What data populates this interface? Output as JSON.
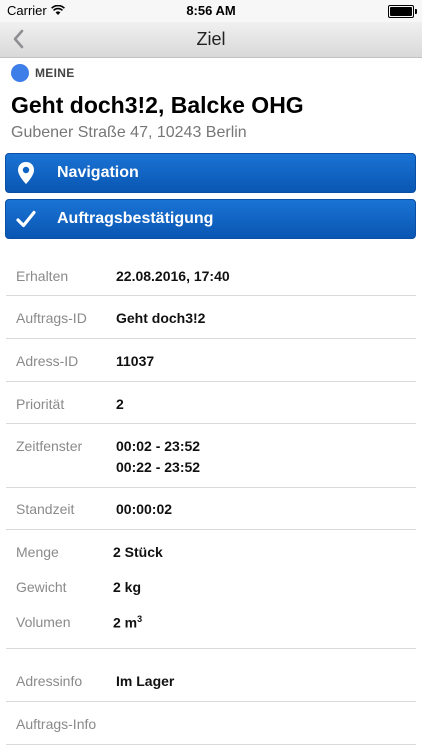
{
  "status_bar": {
    "carrier": "Carrier",
    "time": "8:56 AM",
    "battery_level": 1.0
  },
  "navbar": {
    "title": "Ziel"
  },
  "owner": {
    "label": "MEINE",
    "color": "#3d7ee8"
  },
  "destination": {
    "title": "Geht doch3!2, Balcke OHG",
    "address": "Gubener Straße 47, 10243 Berlin"
  },
  "actions": {
    "navigation_label": "Navigation",
    "confirm_label": "Auftragsbestätigung",
    "button_color": "#0f63c4"
  },
  "details": {
    "erhalten": {
      "label": "Erhalten",
      "value": "22.08.2016, 17:40"
    },
    "auftrags_id": {
      "label": "Auftrags-ID",
      "value": "Geht doch3!2"
    },
    "adress_id": {
      "label": "Adress-ID",
      "value": "11037"
    },
    "prioritaet": {
      "label": "Priorität",
      "value": "2"
    },
    "zeitfenster": {
      "label": "Zeitfenster",
      "values": [
        "00:02 - 23:52",
        "00:22 - 23:52"
      ]
    },
    "standzeit": {
      "label": "Standzeit",
      "value": "00:00:02"
    },
    "menge": {
      "label": "Menge",
      "value": "2 Stück"
    },
    "gewicht": {
      "label": "Gewicht",
      "value": "2 kg"
    },
    "volumen": {
      "label": "Volumen",
      "value": "2 m",
      "unit_exponent": "3"
    },
    "adressinfo": {
      "label": "Adressinfo",
      "value": "Im Lager"
    },
    "auftrags_info": {
      "label": "Auftrags-Info",
      "value": ""
    }
  }
}
